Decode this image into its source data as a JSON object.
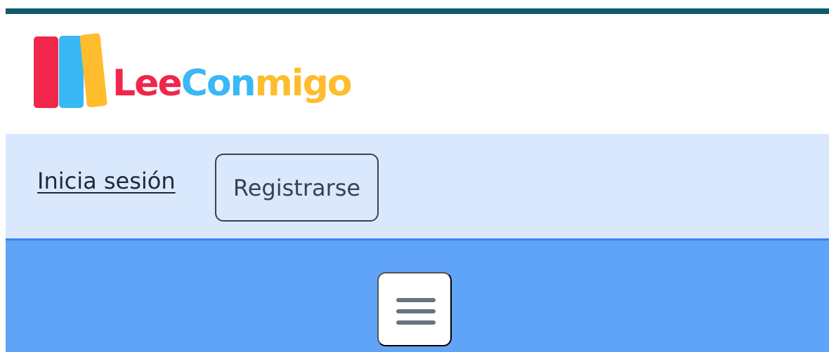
{
  "brand": {
    "logo_parts": [
      "Lee",
      "Con",
      "migo"
    ],
    "colors": {
      "red": "#f0264a",
      "blue": "#3ab8f5",
      "yellow": "#ffbd2e"
    }
  },
  "auth": {
    "login_label": "Inicia sesión",
    "register_label": "Registrarse"
  },
  "menu": {
    "icon": "hamburger-menu-icon"
  },
  "colors": {
    "top_bar": "#0f5b6a",
    "auth_bar_background": "#dae8fd",
    "menu_bar_background": "#60a4f8",
    "menu_bar_border": "#3b82f6"
  }
}
